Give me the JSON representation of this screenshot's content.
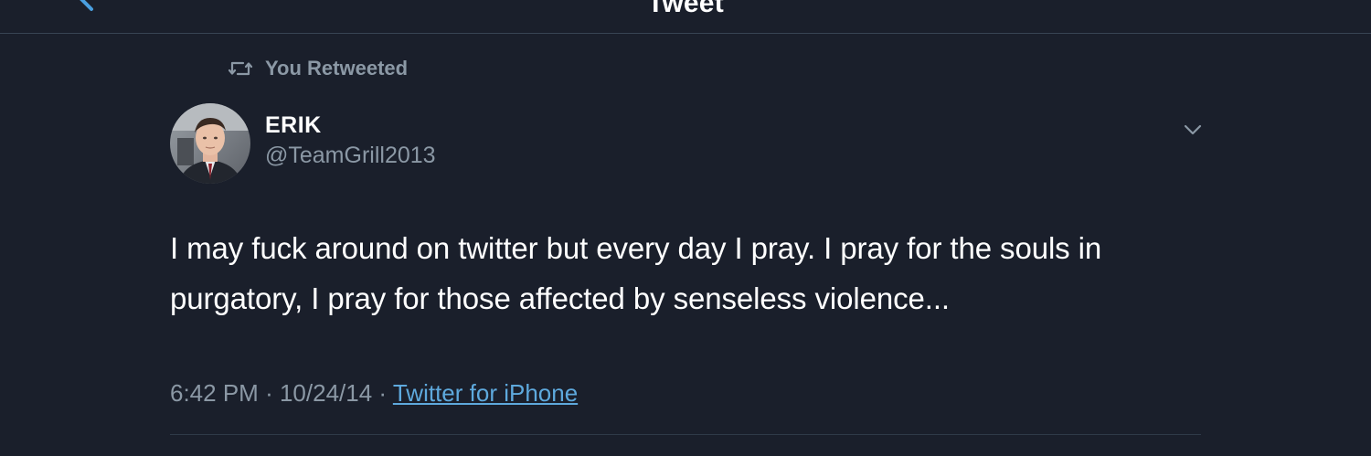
{
  "header": {
    "title": "Tweet",
    "back_icon": "chevron-left-icon"
  },
  "retweet_context": {
    "icon": "retweet-icon",
    "label": "You Retweeted"
  },
  "author": {
    "name": "ERIK",
    "handle": "@TeamGrill2013",
    "avatar": "avatar-photo"
  },
  "tweet": {
    "text": "I may fuck around on twitter but every day I pray. I pray for the souls in purgatory, I pray for those affected by senseless violence...",
    "time": "6:42 PM",
    "date": "10/24/14",
    "separator": "·",
    "source": "Twitter for iPhone"
  },
  "menu_icon": "chevron-down-icon",
  "colors": {
    "background": "#1a1f2b",
    "text_primary": "#ffffff",
    "text_secondary": "#8b98a5",
    "accent": "#5ea9dd"
  }
}
